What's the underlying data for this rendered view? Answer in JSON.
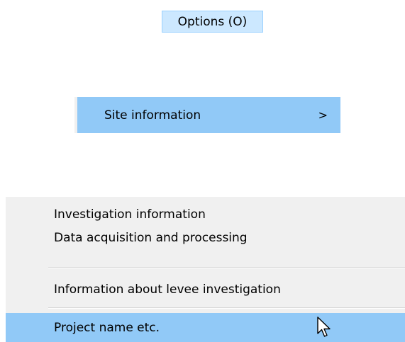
{
  "menubar": {
    "options_label": "Options (O)"
  },
  "submenu": {
    "site_information_label": "Site information",
    "arrow_glyph": ">"
  },
  "dropdown": {
    "items": [
      {
        "label": "Investigation information"
      },
      {
        "label": "Data acquisition and processing"
      },
      {
        "label": "Information about levee investigation"
      },
      {
        "label": "Project name etc."
      }
    ]
  },
  "colors": {
    "menubar_highlight": "#cce8ff",
    "menubar_border": "#99d1ff",
    "item_highlight": "#91c9f7",
    "menu_background": "#f0f0f0"
  },
  "cursor": {
    "icon": "arrow-pointer-icon"
  }
}
